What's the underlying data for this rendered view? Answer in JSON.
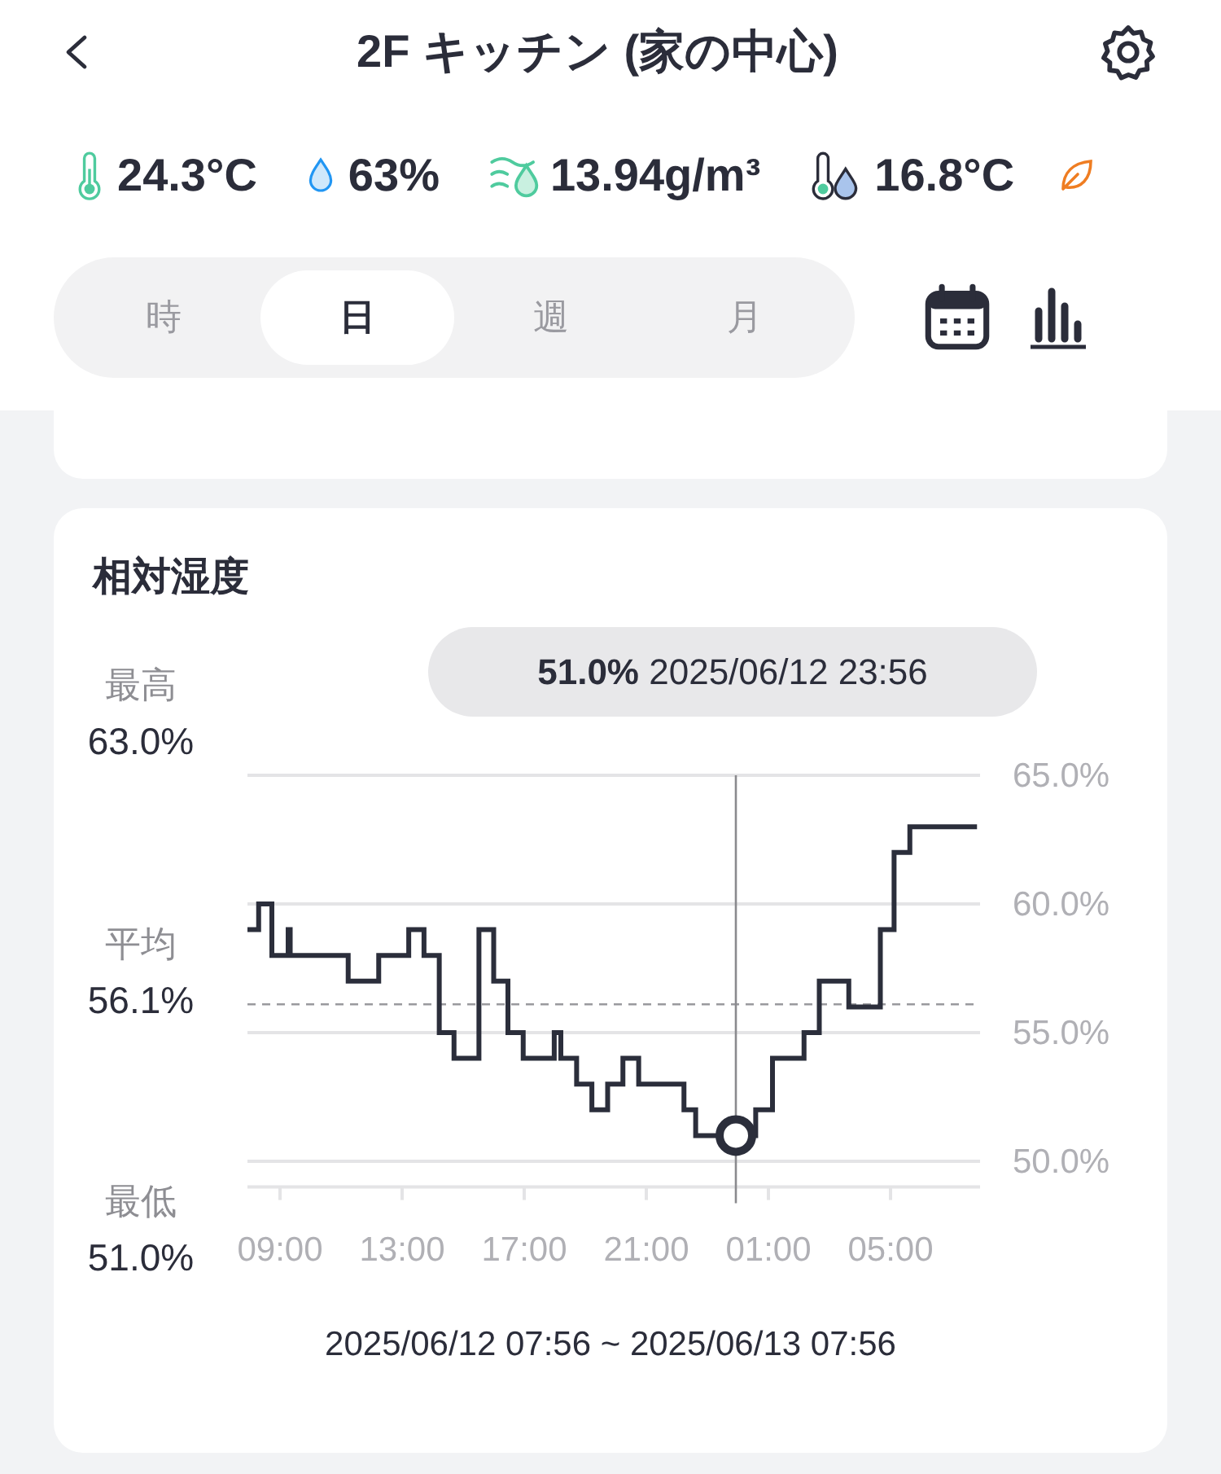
{
  "header": {
    "title": "2F キッチン (家の中心)"
  },
  "readings": [
    {
      "kind": "temperature",
      "value": "24.3°C"
    },
    {
      "kind": "humidity",
      "value": "63%"
    },
    {
      "kind": "absolute_humidity",
      "value": "13.94g/m³"
    },
    {
      "kind": "dew_point",
      "value": "16.8°C"
    }
  ],
  "periods": [
    {
      "label": "時",
      "selected": false
    },
    {
      "label": "日",
      "selected": true
    },
    {
      "label": "週",
      "selected": false
    },
    {
      "label": "月",
      "selected": false
    }
  ],
  "humidity_card": {
    "tooltip": "**51.0%** 2025/06/12 23:56",
    "stats": [
      {
        "label": "最高",
        "value": "63.0%"
      },
      {
        "label": "平均",
        "value": "56.1%"
      },
      {
        "label": "最低",
        "value": "51.0%"
      }
    ],
    "chart_data": {
      "type": "line",
      "title": "相対湿度",
      "grid": true,
      "xlim": [
        "2025-06-12 07:56",
        "2025-06-13 07:56"
      ],
      "ylim": [
        49,
        65
      ],
      "xticks": [
        {
          "value": "2025-06-12 09:00",
          "label": "09:00"
        },
        {
          "value": "2025-06-12 13:00",
          "label": "13:00"
        },
        {
          "value": "2025-06-12 17:00",
          "label": "17:00"
        },
        {
          "value": "2025-06-12 21:00",
          "label": "21:00"
        },
        {
          "value": "2025-06-13 01:00",
          "label": "01:00"
        },
        {
          "value": "2025-06-13 05:00",
          "label": "05:00"
        }
      ],
      "yticks": [
        {
          "value": 50,
          "label": "50.0%"
        },
        {
          "value": 55,
          "label": "55.0%"
        },
        {
          "value": 60,
          "label": "60.0%"
        },
        {
          "value": 65,
          "label": "65.0%"
        }
      ],
      "x": [
        "2025-06-12 07:56",
        "2025-06-12 08:18",
        "2025-06-12 08:18",
        "2025-06-12 08:44",
        "2025-06-12 08:44",
        "2025-06-12 09:16",
        "2025-06-12 09:16",
        "2025-06-12 09:20",
        "2025-06-12 09:20",
        "2025-06-12 11:14",
        "2025-06-12 11:14",
        "2025-06-12 12:14",
        "2025-06-12 12:14",
        "2025-06-12 13:13",
        "2025-06-12 13:13",
        "2025-06-12 13:43",
        "2025-06-12 13:43",
        "2025-06-12 14:13",
        "2025-06-12 14:13",
        "2025-06-12 14:42",
        "2025-06-12 14:42",
        "2025-06-12 15:31",
        "2025-06-12 15:31",
        "2025-06-12 16:00",
        "2025-06-12 16:00",
        "2025-06-12 16:28",
        "2025-06-12 16:28",
        "2025-06-12 16:58",
        "2025-06-12 16:58",
        "2025-06-12 17:59",
        "2025-06-12 17:59",
        "2025-06-12 18:12",
        "2025-06-12 18:12",
        "2025-06-12 18:43",
        "2025-06-12 18:43",
        "2025-06-12 19:13",
        "2025-06-12 19:13",
        "2025-06-12 19:44",
        "2025-06-12 19:44",
        "2025-06-12 20:14",
        "2025-06-12 20:14",
        "2025-06-12 20:45",
        "2025-06-12 20:45",
        "2025-06-12 22:14",
        "2025-06-12 22:14",
        "2025-06-12 22:37",
        "2025-06-12 22:37",
        "2025-06-13 00:35",
        "2025-06-13 00:35",
        "2025-06-13 01:08",
        "2025-06-13 01:08",
        "2025-06-13 02:10",
        "2025-06-13 02:10",
        "2025-06-13 02:40",
        "2025-06-13 02:40",
        "2025-06-13 03:38",
        "2025-06-13 03:38",
        "2025-06-13 04:40",
        "2025-06-13 04:40",
        "2025-06-13 05:07",
        "2025-06-13 05:07",
        "2025-06-13 05:38",
        "2025-06-13 05:38",
        "2025-06-13 07:50"
      ],
      "series": [
        {
          "color": "#2b2e3b",
          "values": [
            59,
            59,
            60,
            60,
            58,
            58,
            59,
            59,
            58,
            58,
            57,
            57,
            58,
            58,
            59,
            59,
            58,
            58,
            55,
            55,
            54,
            54,
            59,
            59,
            57,
            57,
            55,
            55,
            54,
            54,
            55,
            55,
            54,
            54,
            53,
            53,
            52,
            52,
            53,
            53,
            54,
            54,
            53,
            53,
            52,
            52,
            51,
            51,
            52,
            52,
            54,
            54,
            55,
            55,
            57,
            57,
            56,
            56,
            59,
            59,
            62,
            62,
            63,
            63
          ]
        }
      ],
      "ref_lines": [
        {
          "axis": "y",
          "value": 56.1
        },
        {
          "axis": "x",
          "value": "2025-06-12 23:56"
        }
      ]
    },
    "range": "2025/06/12 07:56 ~ 2025/06/13 07:56"
  }
}
